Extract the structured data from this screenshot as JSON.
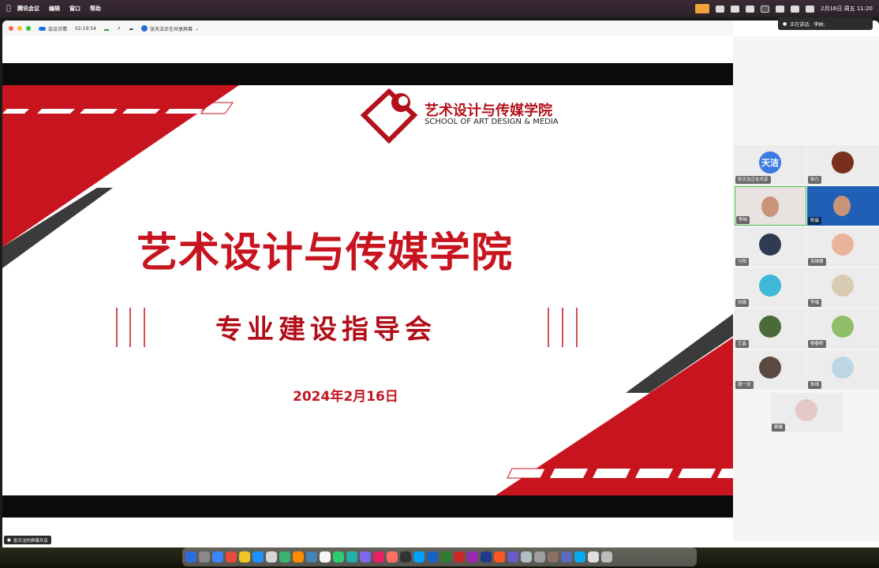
{
  "menubar": {
    "app": "腾讯会议",
    "items": [
      "编辑",
      "窗口",
      "帮助"
    ],
    "datetime": "2月16日 周五 11:20"
  },
  "titlebar": {
    "meeting_details": "会议详情",
    "duration": "02:19:54",
    "sharing_label": "张天洁正在共享屏幕"
  },
  "speaking": {
    "label": "正在讲话:",
    "name": "李纳;"
  },
  "slide": {
    "logo_cn": "艺术设计与传媒学院",
    "logo_en": "SCHOOL OF ART DESIGN & MEDIA",
    "title": "艺术设计与传媒学院",
    "subtitle": "专业建设指导会",
    "date": "2024年2月16日",
    "colors": {
      "red": "#c8141f",
      "dark": "#3b3b3b"
    }
  },
  "participants": [
    {
      "name": "张天洁正在共享",
      "avatar_text": "天洁",
      "kind": "text"
    },
    {
      "name": "钟凡",
      "kind": "avatar",
      "color": "#7a2f1e"
    },
    {
      "name": "李纳",
      "kind": "video",
      "color": "#e8e2e0",
      "active": true
    },
    {
      "name": "陈晨",
      "kind": "video",
      "color": "#1f5fb5"
    },
    {
      "name": "付阳",
      "kind": "avatar",
      "color": "#2f3b52"
    },
    {
      "name": "吴维娜",
      "kind": "avatar",
      "color": "#e9b59a"
    },
    {
      "name": "刘婧",
      "kind": "avatar",
      "color": "#3fb8d8"
    },
    {
      "name": "李璐",
      "kind": "avatar",
      "color": "#d9cbb3"
    },
    {
      "name": "王晶",
      "kind": "avatar",
      "color": "#4a6a3a"
    },
    {
      "name": "杨春桥",
      "kind": "avatar",
      "color": "#8fbd6a"
    },
    {
      "name": "唐一龙",
      "kind": "avatar",
      "color": "#5a4a40"
    },
    {
      "name": "朱琦",
      "kind": "avatar",
      "color": "#bcd6e6"
    },
    {
      "name": "蔡婕",
      "kind": "avatar",
      "color": "#e4c8c8"
    }
  ],
  "sharer_tag": "张天洁的屏幕共享",
  "dock": {
    "icon_colors": [
      "#2a6de0",
      "#8a8a8a",
      "#3a86ff",
      "#e74c3c",
      "#f3c623",
      "#1e90ff",
      "#d6d6d6",
      "#3cb371",
      "#ff8c00",
      "#4682b4",
      "#f5f5f5",
      "#2ecc71",
      "#20b2aa",
      "#7b68ee",
      "#e91e63",
      "#ff6f61",
      "#333333",
      "#00a2ff",
      "#1565c0",
      "#2e7d32",
      "#c62828",
      "#9c27b0",
      "#1e3a8a",
      "#ff5722",
      "#6a5acd",
      "#b0bec5",
      "#9e9e9e",
      "#8d6e63",
      "#5c6bc0",
      "#03a9f4",
      "#e0e0e0",
      "#bdbdbd"
    ]
  }
}
